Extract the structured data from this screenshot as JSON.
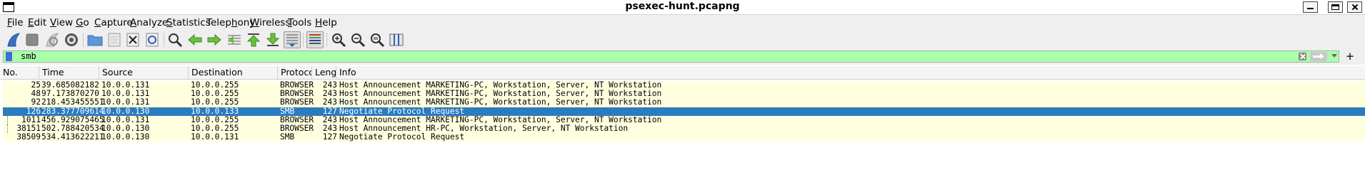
{
  "window": {
    "title": "psexec-hunt.pcapng"
  },
  "menu": [
    {
      "pre": "",
      "accel": "F",
      "post": "ile"
    },
    {
      "pre": "",
      "accel": "E",
      "post": "dit"
    },
    {
      "pre": "",
      "accel": "V",
      "post": "iew"
    },
    {
      "pre": "",
      "accel": "G",
      "post": "o"
    },
    {
      "pre": "",
      "accel": "C",
      "post": "apture"
    },
    {
      "pre": "",
      "accel": "A",
      "post": "nalyze"
    },
    {
      "pre": "",
      "accel": "S",
      "post": "tatistics"
    },
    {
      "pre": "Telep",
      "accel": "h",
      "post": "ony"
    },
    {
      "pre": "",
      "accel": "W",
      "post": "ireless"
    },
    {
      "pre": "",
      "accel": "T",
      "post": "ools"
    },
    {
      "pre": "",
      "accel": "H",
      "post": "elp"
    }
  ],
  "toolbar": {
    "icons": [
      "shark-fin-start-icon",
      "stop-square-icon",
      "restart-fin-icon",
      "capture-options-gear-icon",
      "open-folder-icon",
      "save-file-icon",
      "close-file-icon",
      "reload-file-icon",
      "find-packet-icon",
      "go-back-icon",
      "go-forward-icon",
      "go-to-packet-icon",
      "first-packet-icon",
      "last-packet-icon",
      "autoscroll-icon",
      "colorize-icon",
      "zoom-in-icon",
      "zoom-out-icon",
      "normal-size-icon",
      "resize-columns-icon"
    ]
  },
  "filter": {
    "value": "smb",
    "add_label": "+"
  },
  "colors": {
    "filter_valid_bg": "#aaffaa",
    "row_bg": "#ffffe0",
    "selected_bg": "#2b7bbf"
  },
  "columns": [
    "No.",
    "Time",
    "Source",
    "Destination",
    "Protocol",
    "Length",
    "Info"
  ],
  "packets": [
    {
      "no": "25",
      "time": "39.685082182",
      "src": "10.0.0.131",
      "dst": "10.0.0.255",
      "proto": "BROWSER",
      "len": "243",
      "info": "Host Announcement MARKETING-PC, Workstation, Server, NT Workstation",
      "selected": false,
      "related": false
    },
    {
      "no": "48",
      "time": "97.173870270",
      "src": "10.0.0.131",
      "dst": "10.0.0.255",
      "proto": "BROWSER",
      "len": "243",
      "info": "Host Announcement MARKETING-PC, Workstation, Server, NT Workstation",
      "selected": false,
      "related": false
    },
    {
      "no": "92",
      "time": "218.453455551",
      "src": "10.0.0.131",
      "dst": "10.0.0.255",
      "proto": "BROWSER",
      "len": "243",
      "info": "Host Announcement MARKETING-PC, Workstation, Server, NT Workstation",
      "selected": false,
      "related": false
    },
    {
      "no": "126",
      "time": "283.377709614",
      "src": "10.0.0.130",
      "dst": "10.0.0.133",
      "proto": "SMB",
      "len": "127",
      "info": "Negotiate Protocol Request",
      "selected": true,
      "related": true
    },
    {
      "no": "1011",
      "time": "456.929075465",
      "src": "10.0.0.131",
      "dst": "10.0.0.255",
      "proto": "BROWSER",
      "len": "243",
      "info": "Host Announcement MARKETING-PC, Workstation, Server, NT Workstation",
      "selected": false,
      "related": true
    },
    {
      "no": "38151",
      "time": "502.788420534",
      "src": "10.0.0.130",
      "dst": "10.0.0.255",
      "proto": "BROWSER",
      "len": "243",
      "info": "Host Announcement HR-PC, Workstation, Server, NT Workstation",
      "selected": false,
      "related": true
    },
    {
      "no": "38509",
      "time": "534.413622211",
      "src": "10.0.0.130",
      "dst": "10.0.0.131",
      "proto": "SMB",
      "len": "127",
      "info": "Negotiate Protocol Request",
      "selected": false,
      "related": false
    }
  ]
}
